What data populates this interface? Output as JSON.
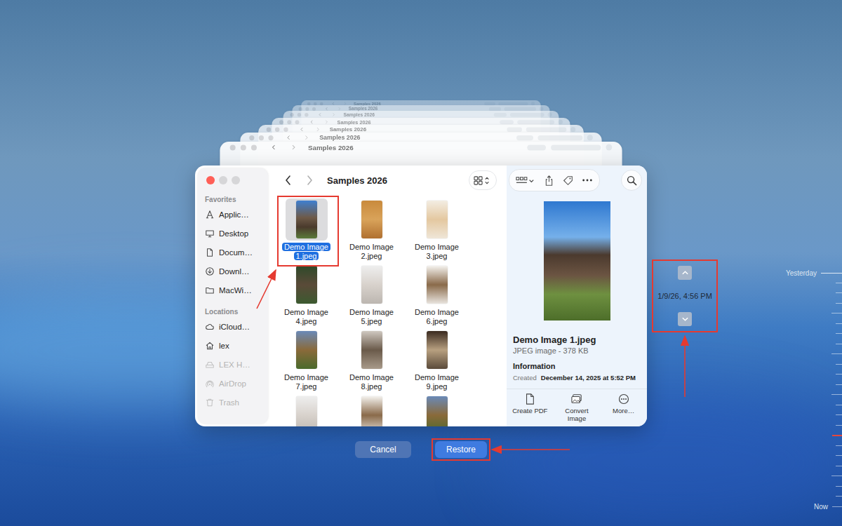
{
  "window": {
    "title": "Samples 2026"
  },
  "background_windows": [
    {
      "title": "Samples 2026"
    },
    {
      "title": "Samples 2026"
    },
    {
      "title": "Samples 2026"
    },
    {
      "title": "Samples 2026"
    },
    {
      "title": "Samples 2026"
    },
    {
      "title": "Samples 2026"
    },
    {
      "title": "Samples 2026"
    }
  ],
  "sidebar": {
    "sections": [
      {
        "title": "Favorites",
        "items": [
          {
            "label": "Applic…",
            "disabled": false
          },
          {
            "label": "Desktop",
            "disabled": false
          },
          {
            "label": "Docum…",
            "disabled": false
          },
          {
            "label": "Downl…",
            "disabled": false
          },
          {
            "label": "MacWi…",
            "disabled": false
          }
        ]
      },
      {
        "title": "Locations",
        "items": [
          {
            "label": "iCloud…",
            "disabled": false
          },
          {
            "label": "lex",
            "disabled": false
          },
          {
            "label": "LEX H…",
            "disabled": true
          },
          {
            "label": "AirDrop",
            "disabled": true
          },
          {
            "label": "Trash",
            "disabled": true
          }
        ]
      }
    ]
  },
  "files": [
    {
      "name": "Demo Image 1.jpeg",
      "selected": true
    },
    {
      "name": "Demo Image 2.jpeg",
      "selected": false
    },
    {
      "name": "Demo Image 3.jpeg",
      "selected": false
    },
    {
      "name": "Demo Image 4.jpeg",
      "selected": false
    },
    {
      "name": "Demo Image 5.jpeg",
      "selected": false
    },
    {
      "name": "Demo Image 6.jpeg",
      "selected": false
    },
    {
      "name": "Demo Image 7.jpeg",
      "selected": false
    },
    {
      "name": "Demo Image 8.jpeg",
      "selected": false
    },
    {
      "name": "Demo Image 9.jpeg",
      "selected": false
    }
  ],
  "partial_row": [
    {
      "selected": false
    },
    {
      "selected": false
    },
    {
      "selected": false
    }
  ],
  "preview": {
    "name": "Demo Image 1.jpeg",
    "kind": "JPEG image - 378 KB",
    "section": "Information",
    "created_label": "Created",
    "created_value": "December 14, 2025 at 5:52 PM",
    "actions": [
      {
        "label": "Create PDF"
      },
      {
        "label": "Convert Image"
      },
      {
        "label": "More…"
      }
    ]
  },
  "buttons": [
    {
      "label": "Cancel"
    },
    {
      "label": "Restore"
    }
  ],
  "time_control": {
    "date": "1/9/26, 4:56 PM"
  },
  "timeline": {
    "start_label": "Yesterday",
    "end_label": "Now",
    "ticks": [
      {
        "selected": false
      },
      {
        "selected": false
      },
      {
        "selected": false
      },
      {
        "selected": false
      },
      {
        "selected": false
      },
      {
        "selected": false
      },
      {
        "selected": false
      },
      {
        "selected": false
      },
      {
        "selected": false
      },
      {
        "selected": false
      },
      {
        "selected": false
      },
      {
        "selected": false
      },
      {
        "selected": false
      },
      {
        "selected": false
      },
      {
        "selected": false
      },
      {
        "selected": true
      },
      {
        "selected": false
      },
      {
        "selected": false
      },
      {
        "selected": false
      },
      {
        "selected": false
      },
      {
        "selected": false
      },
      {
        "selected": false
      }
    ]
  }
}
